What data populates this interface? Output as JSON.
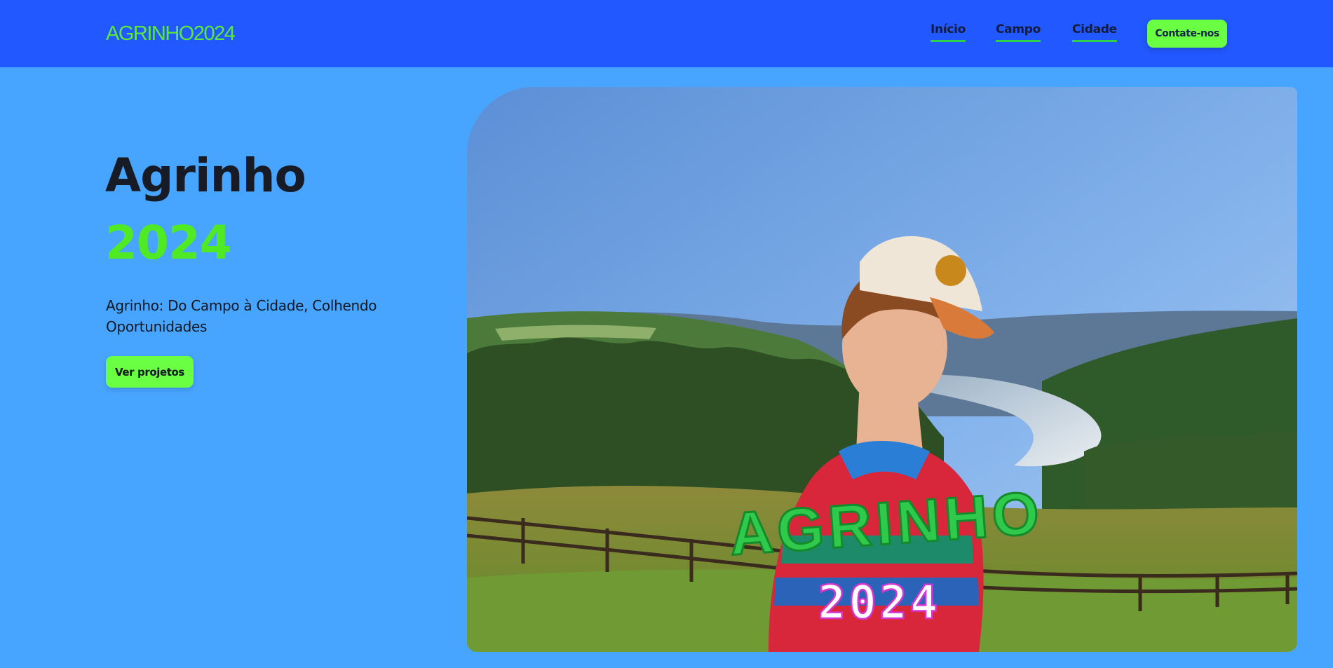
{
  "header": {
    "logo": "AGRINHO2024",
    "nav": [
      {
        "label": "Início"
      },
      {
        "label": "Campo"
      },
      {
        "label": "Cidade"
      }
    ],
    "contact_label": "Contate-nos"
  },
  "hero": {
    "title": "Agrinho",
    "year": "2024",
    "subtitle": "Agrinho: Do Campo à Cidade, Colhendo Oportunidades",
    "cta_label": "Ver projetos",
    "image": {
      "overlay_title": "AGRINHO",
      "overlay_year": "2024"
    }
  },
  "colors": {
    "header_bg": "#2258ff",
    "page_bg": "#48a5ff",
    "accent_green": "#6aff42",
    "logo_green": "#5ae83a"
  }
}
